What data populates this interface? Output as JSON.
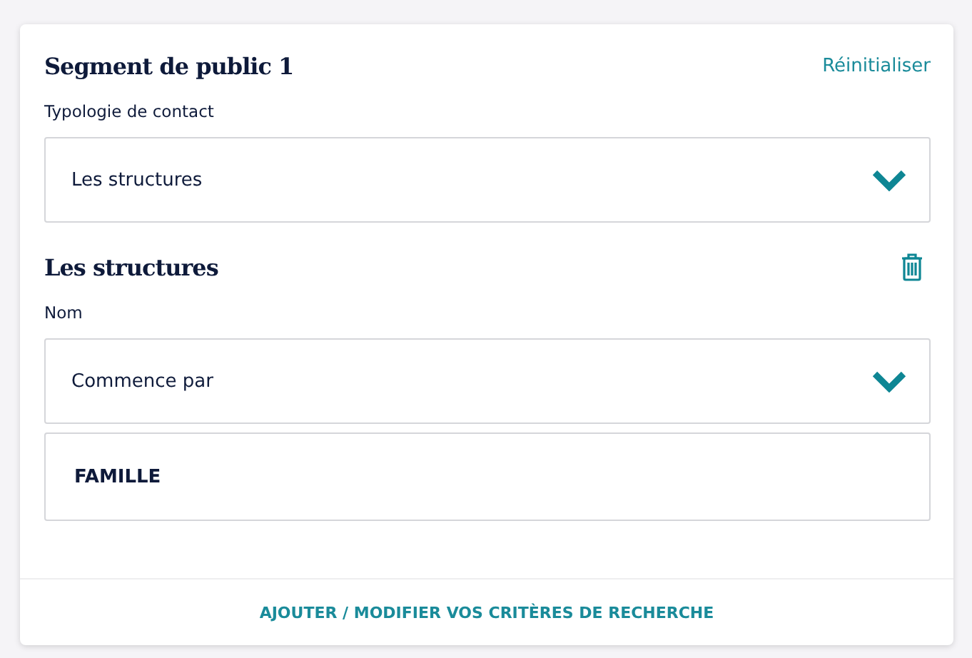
{
  "card": {
    "title": "Segment de public 1",
    "reset_link": "Réinitialiser"
  },
  "contact_type": {
    "label": "Typologie de contact",
    "value": "Les structures"
  },
  "section": {
    "title": "Les structures",
    "fields": [
      {
        "kind": "select",
        "label": "Nom",
        "value": "Commence par"
      },
      {
        "kind": "text",
        "value": "FAMILLE"
      }
    ]
  },
  "footer_link": "AJOUTER / MODIFIER VOS CRITÈRES DE RECHERCHE"
}
